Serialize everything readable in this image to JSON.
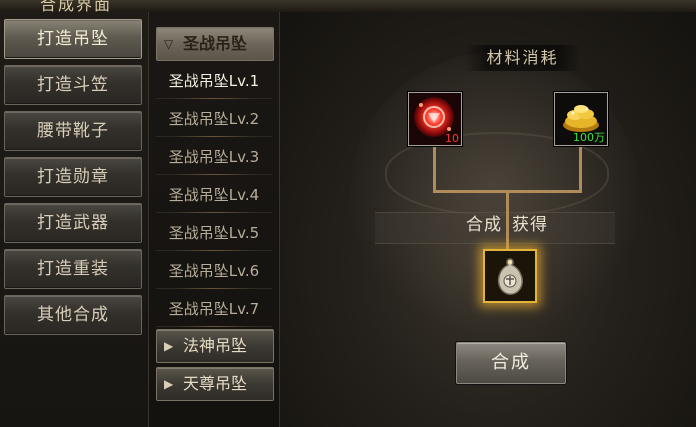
{
  "window": {
    "title": "合成界面"
  },
  "categories": [
    {
      "label": "打造吊坠",
      "active": true
    },
    {
      "label": "打造斗笠",
      "active": false
    },
    {
      "label": "腰带靴子",
      "active": false
    },
    {
      "label": "打造勋章",
      "active": false
    },
    {
      "label": "打造武器",
      "active": false
    },
    {
      "label": "打造重装",
      "active": false
    },
    {
      "label": "其他合成",
      "active": false
    }
  ],
  "item_list": {
    "open_group": {
      "label": "圣战吊坠",
      "arrow": "▽"
    },
    "sub_items": [
      "圣战吊坠Lv.1",
      "圣战吊坠Lv.2",
      "圣战吊坠Lv.3",
      "圣战吊坠Lv.4",
      "圣战吊坠Lv.5",
      "圣战吊坠Lv.6",
      "圣战吊坠Lv.7"
    ],
    "selected_index": 0,
    "closed_groups": [
      {
        "label": "法神吊坠",
        "arrow": "▶"
      },
      {
        "label": "天尊吊坠",
        "arrow": "▶"
      }
    ]
  },
  "materials": {
    "title": "材料消耗",
    "items": [
      {
        "icon": "red-gem-icon",
        "qty": "10"
      },
      {
        "icon": "gold-coins-icon",
        "qty": "100万"
      }
    ]
  },
  "result": {
    "label_left": "合成",
    "label_right": "获得",
    "icon": "pendant-icon"
  },
  "craft_button": "合成",
  "colors": {
    "accent_gold": "#e2b43c",
    "qty_red": "#ff3b2b",
    "qty_green": "#3ee23e",
    "connector": "#b08c5a"
  }
}
